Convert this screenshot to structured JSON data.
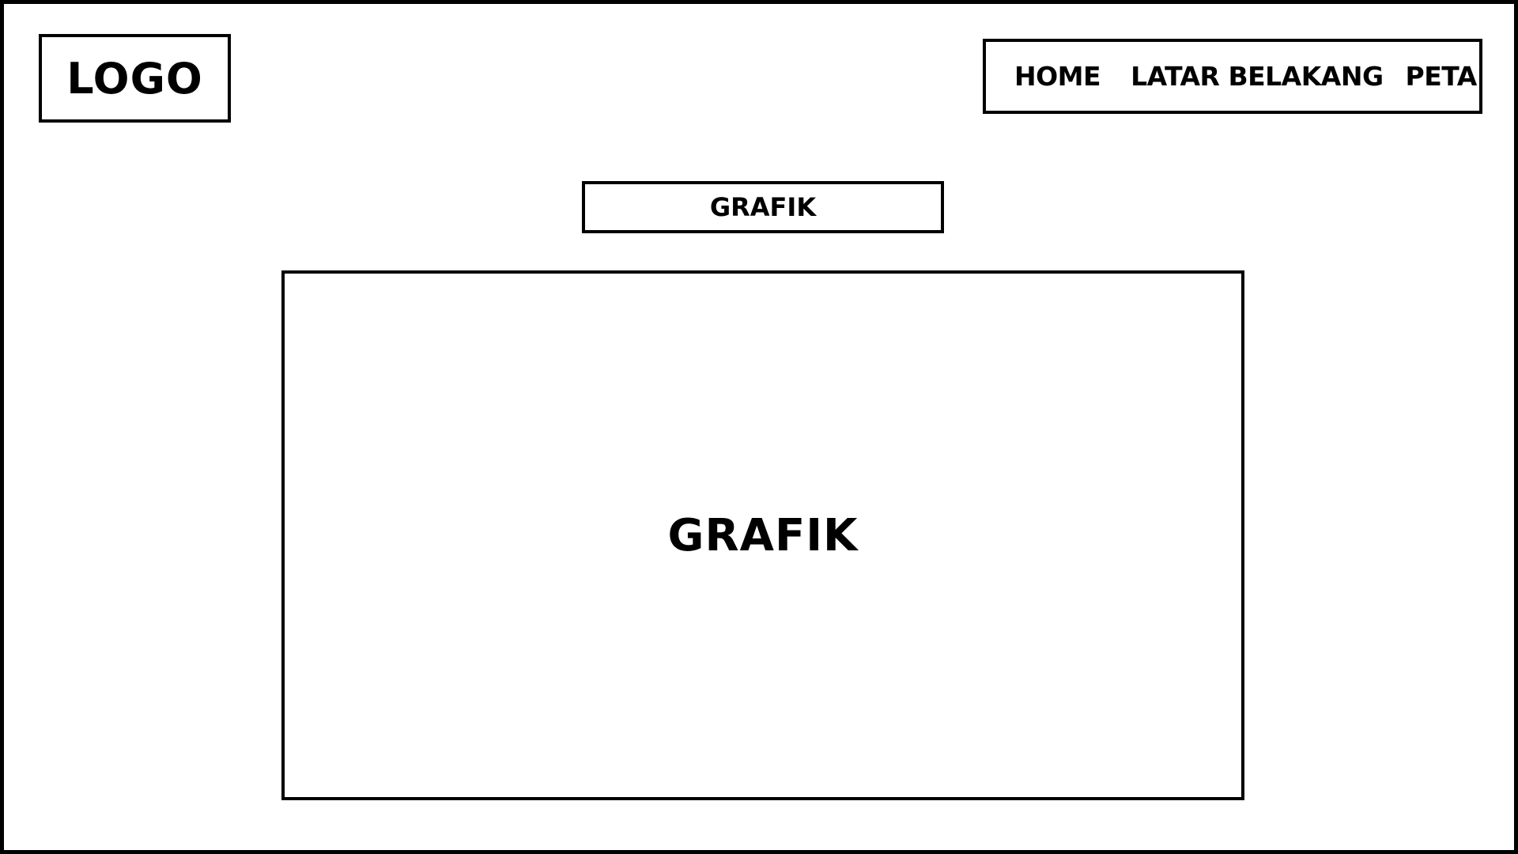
{
  "header": {
    "logo_text": "LOGO",
    "nav": {
      "home": "HOME",
      "latar_belakang": "LATAR BELAKANG",
      "peta": "PETA"
    }
  },
  "main": {
    "section_tab_label": "GRAFIK",
    "panel_label": "GRAFIK"
  }
}
